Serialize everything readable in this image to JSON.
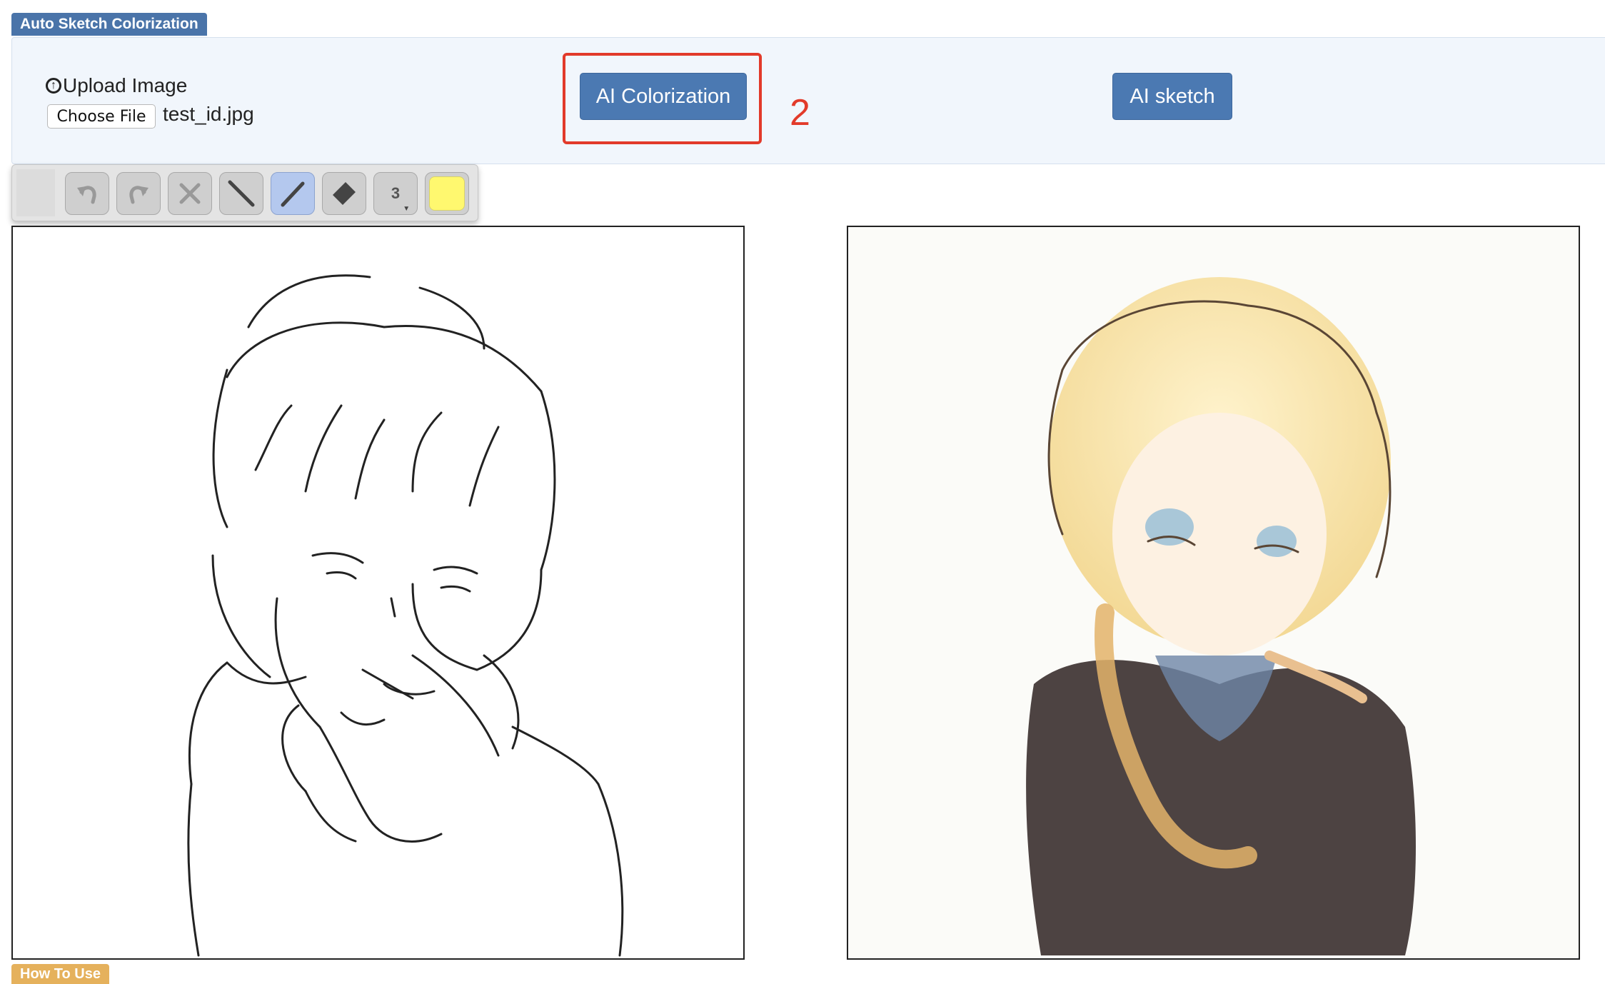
{
  "app": {
    "title": "Auto Sketch Colorization"
  },
  "upload": {
    "title": "Upload Image",
    "choose_file_label": "Choose File",
    "file_name": "test_id.jpg"
  },
  "actions": {
    "colorize_label": "AI Colorization",
    "sketch_label": "AI sketch"
  },
  "annotation": {
    "step_number": "2",
    "color": "#e23a2a"
  },
  "toolbar": {
    "tools": [
      {
        "name": "undo-icon",
        "active": false
      },
      {
        "name": "redo-icon",
        "active": false
      },
      {
        "name": "clear-icon",
        "active": false
      },
      {
        "name": "line-icon",
        "active": false
      },
      {
        "name": "pen-icon",
        "active": true
      },
      {
        "name": "eraser-icon",
        "active": false
      }
    ],
    "brush_size": "3",
    "current_color": "#fff86f"
  },
  "colors": {
    "accent": "#4b79b2",
    "panel_bg": "#f1f6fc",
    "howto_tab": "#e5b15c"
  },
  "footer": {
    "how_to_use_label": "How To Use"
  }
}
